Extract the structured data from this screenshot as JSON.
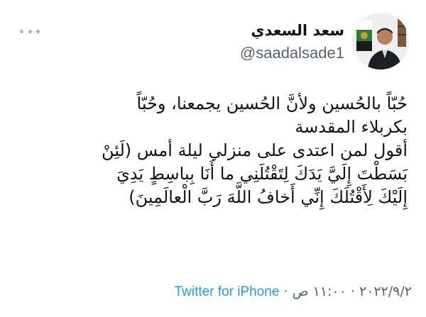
{
  "tweet": {
    "author": {
      "display_name": "سعد السعدي",
      "handle": "@saadalsade1",
      "avatar_icon": "profile-photo"
    },
    "more_icon": "more-horizontal-icon",
    "text_lines": [
      "حُبّاً بالحُسين ولأنَّ الحُسين يجمعنا، وحُبّاً",
      "بكربلاء المقدسة",
      "أقول لمن اعتدى على منزلي ليلة أمس (لَئِنْ",
      "بَسَطْتَ إِلَيَّ يَدَكَ لِتَقْتُلَنِي ما أَنَا بِباسِطٍ يَدِيَ",
      "إِلَيْكَ لِأَقْتُلَكَ إِنِّي أَخافُ اللَّهَ رَبَّ الْعالَمِينَ)"
    ],
    "date": "٢٠٢٢/٩/٢",
    "separator": "·",
    "time": "١١:٠٠ ص",
    "source": "Twitter for iPhone",
    "colors": {
      "text": "#0f1419",
      "secondary": "#536471",
      "link": "#1d9bf0",
      "dots": "#a8b3bd"
    }
  }
}
